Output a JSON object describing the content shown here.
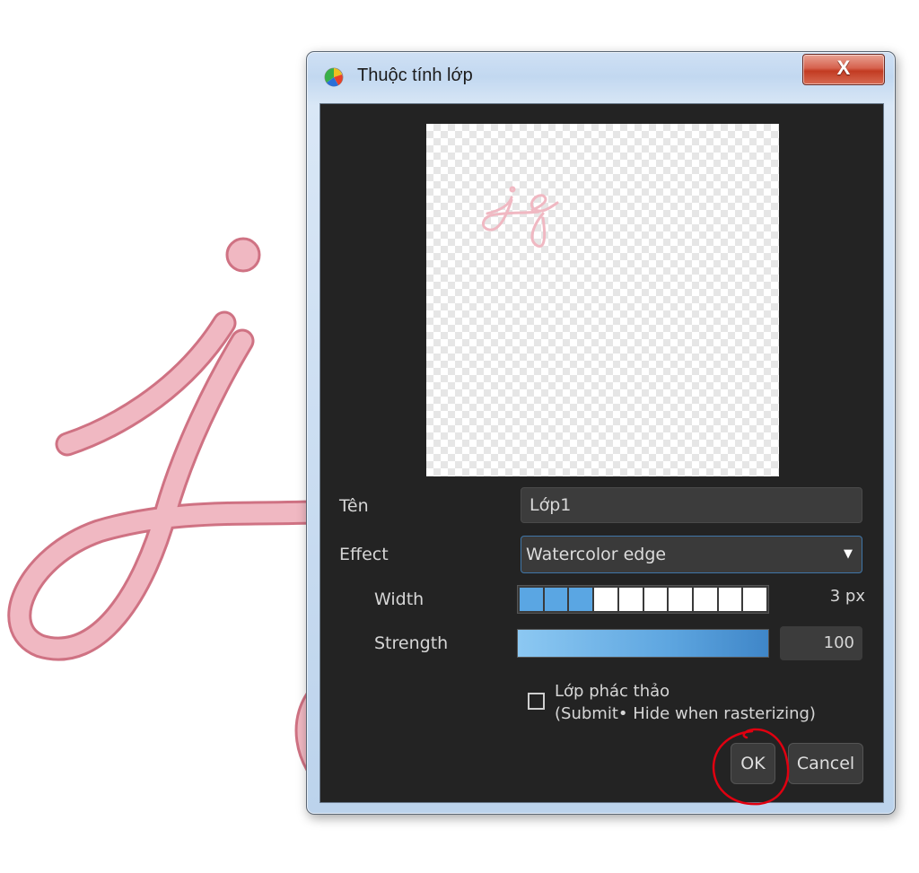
{
  "window": {
    "title": "Thuộc tính lớp",
    "close_glyph": "X"
  },
  "form": {
    "name_label": "Tên",
    "name_value": "Lớp1",
    "effect_label": "Effect",
    "effect_value": "Watercolor edge",
    "width_label": "Width",
    "width_value": "3 px",
    "width_level": 3,
    "width_max": 10,
    "strength_label": "Strength",
    "strength_value": "100",
    "strength_level": 100,
    "sketch_label_line1": "Lớp phác thảo",
    "sketch_label_line2": "(Submit• Hide when rasterizing)",
    "sketch_checked": false
  },
  "buttons": {
    "ok": "OK",
    "cancel": "Cancel"
  },
  "colors": {
    "stroke": "#f0b8c2",
    "stroke_edge": "#cf7283",
    "slider_on": "#5aa6e3",
    "annotation": "#e00010"
  },
  "icons": {
    "app": "color-wheel-icon",
    "close": "close-icon",
    "dropdown": "chevron-down-icon"
  }
}
